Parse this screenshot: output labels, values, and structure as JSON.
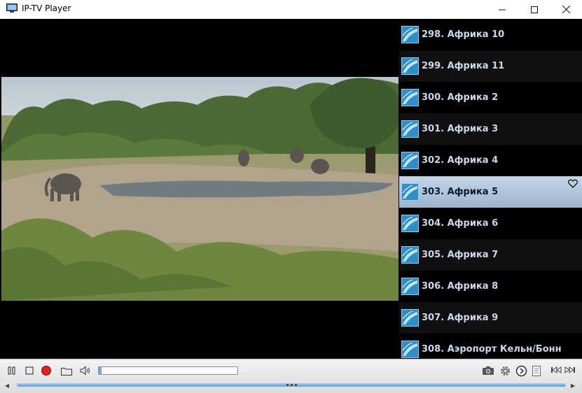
{
  "window": {
    "title": "IP-TV Player",
    "buttons": {
      "minimize": "—",
      "maximize": "☐",
      "close": "✕"
    }
  },
  "playlist": {
    "items": [
      {
        "label": "298. Африка 10",
        "selected": false,
        "favorite": false
      },
      {
        "label": "299. Африка 11",
        "selected": false,
        "favorite": false
      },
      {
        "label": "300. Африка 2",
        "selected": false,
        "favorite": false
      },
      {
        "label": "301. Африка 3",
        "selected": false,
        "favorite": false
      },
      {
        "label": "302. Африка 4",
        "selected": false,
        "favorite": false
      },
      {
        "label": "303. Африка 5",
        "selected": true,
        "favorite": true
      },
      {
        "label": "304. Африка 6",
        "selected": false,
        "favorite": false
      },
      {
        "label": "305. Африка 7",
        "selected": false,
        "favorite": false
      },
      {
        "label": "306. Африка 8",
        "selected": false,
        "favorite": false
      },
      {
        "label": "307. Африка 9",
        "selected": false,
        "favorite": false
      },
      {
        "label": "308. Аэропорт Кельн/Бонн",
        "selected": false,
        "favorite": false
      }
    ]
  },
  "controls": {
    "icons": [
      "pause-icon",
      "stop-icon",
      "record-icon",
      "folder-icon",
      "volume-icon",
      "camera-icon",
      "gear-icon",
      "clock-icon",
      "list-icon",
      "previous-icon",
      "next-icon"
    ],
    "volume_level": 0.02,
    "seek_position": 0.5
  },
  "colors": {
    "selected_row": "#b4c8de",
    "playlist_text": "#c9d8ec",
    "record": "#e02020",
    "seek": "#6aa5da"
  }
}
